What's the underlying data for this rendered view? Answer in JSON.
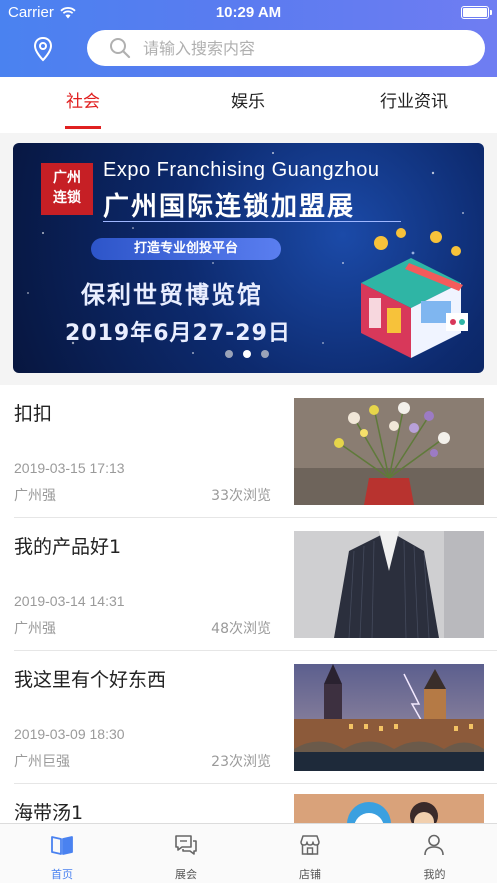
{
  "status_bar": {
    "carrier": "Carrier",
    "time": "10:29 AM"
  },
  "search": {
    "placeholder": "请输入搜索内容"
  },
  "icons": {
    "location": "location-pin-icon",
    "search": "search-icon"
  },
  "tabs": [
    {
      "label": "社会",
      "active": true
    },
    {
      "label": "娱乐",
      "active": false
    },
    {
      "label": "行业资讯",
      "active": false
    }
  ],
  "banner": {
    "logo_line1": "广州",
    "logo_line2": "连锁",
    "english_title": "Expo Franchising Guangzhou",
    "chinese_title": "广州国际连锁加盟展",
    "tagline": "打造专业创投平台",
    "venue": "保利世贸博览馆",
    "date": "2019年6月27-29日",
    "page_count": 3,
    "current_page": 2
  },
  "news": [
    {
      "title": "扣扣",
      "date": "2019-03-15 17:13",
      "author": "广州强",
      "views": "33次浏览",
      "thumb": "flower-vase-photo"
    },
    {
      "title": "我的产品好1",
      "date": "2019-03-14 14:31",
      "author": "广州强",
      "views": "48次浏览",
      "thumb": "suit-jacket-photo"
    },
    {
      "title": "我这里有个好东西",
      "date": "2019-03-09 18:30",
      "author": "广州巨强",
      "views": "23次浏览",
      "thumb": "city-night-photo"
    },
    {
      "title": "海带汤1",
      "date": "",
      "author": "",
      "views": "",
      "thumb": "cartoon-photo"
    }
  ],
  "tabbar": [
    {
      "label": "首页",
      "icon": "book-icon",
      "active": true
    },
    {
      "label": "展会",
      "icon": "chat-bubbles-icon",
      "active": false
    },
    {
      "label": "店铺",
      "icon": "store-icon",
      "active": false
    },
    {
      "label": "我的",
      "icon": "person-icon",
      "active": false
    }
  ],
  "colors": {
    "accent": "#4a82f0",
    "tab_active": "#e02020",
    "muted_text": "#9a9a9a"
  }
}
